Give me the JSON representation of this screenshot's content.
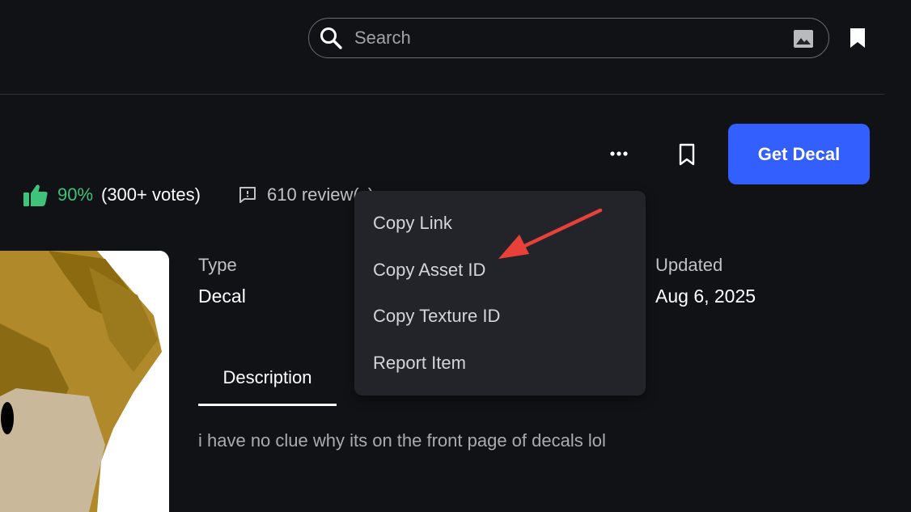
{
  "search": {
    "placeholder": "Search"
  },
  "actions": {
    "get_label": "Get Decal"
  },
  "votes": {
    "percent": "90%",
    "count": "(300+ votes)"
  },
  "reviews": {
    "label": "610 review(s)"
  },
  "details": {
    "type_label": "Type",
    "type_value": "Decal",
    "updated_label": "Updated",
    "updated_value": "Aug 6, 2025"
  },
  "tabs": {
    "description_label": "Description"
  },
  "description": {
    "text": "i have no clue why its on the front page of decals lol"
  },
  "context_menu": {
    "items": [
      {
        "label": "Copy Link"
      },
      {
        "label": "Copy Asset ID"
      },
      {
        "label": "Copy Texture ID"
      },
      {
        "label": "Report Item"
      }
    ]
  },
  "colors": {
    "background": "#111216",
    "accent_button": "#335fff",
    "vote_green": "#3fc27a",
    "menu_background": "#232429",
    "annotation_arrow": "#e8413a"
  },
  "icons": {
    "search": "search-icon",
    "image_search": "image-search-icon",
    "bookmark": "bookmark-icon",
    "more": "more-dots-icon",
    "thumbs_up": "thumbs-up-icon",
    "review": "review-chat-icon"
  }
}
